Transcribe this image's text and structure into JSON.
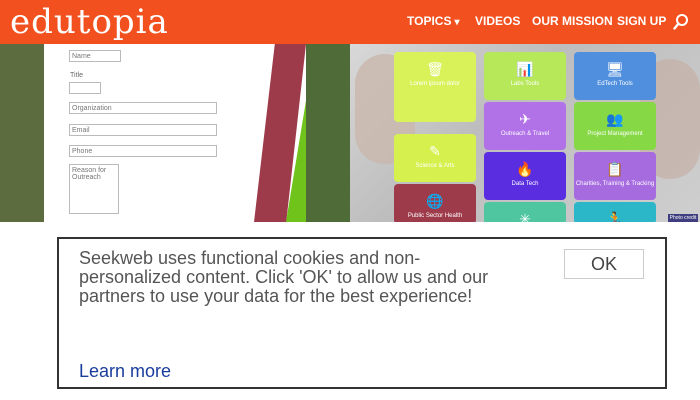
{
  "header": {
    "logo": "edutopia",
    "nav": {
      "topics": "TOPICS",
      "videos": "VIDEOS",
      "mission": "OUR MISSION",
      "signup": "SIGN UP"
    },
    "icons": [
      "chevron-down-icon",
      "search-icon"
    ],
    "brand_color": "#f2511f"
  },
  "hero": {
    "form": {
      "name_placeholder": "Name",
      "title_label": "Title",
      "organization_placeholder": "Organization",
      "email_placeholder": "Email",
      "phone_placeholder": "Phone",
      "comment_placeholder": "Reason for Outreach"
    },
    "tiles": [
      {
        "label": "Lorem ipsum dolor",
        "icon": "trash-icon",
        "color": "#d9f25a"
      },
      {
        "label": "Labs Tools",
        "icon": "chart-icon",
        "color": "#b7e85a"
      },
      {
        "label": "EdTech Tools",
        "icon": "monitor-icon",
        "color": "#4f8fde"
      },
      {
        "label": "Science & Arts",
        "icon": "pencil-icon",
        "color": "#d6f04d"
      },
      {
        "label": "Outreach & Travel",
        "icon": "plane-icon",
        "color": "#b172e8"
      },
      {
        "label": "Project Management",
        "icon": "people-icon",
        "color": "#86d845"
      },
      {
        "label": "Public Sector Health",
        "icon": "globe-icon",
        "color": "#9e3b4b"
      },
      {
        "label": "Data Tech",
        "icon": "fire-icon",
        "color": "#5a2ee0"
      },
      {
        "label": "Charities, Training & Tracking",
        "icon": "clipboard-icon",
        "color": "#a56bdf"
      },
      {
        "label": "",
        "icon": "plant-icon",
        "color": "#4fc6a0"
      },
      {
        "label": "",
        "icon": "running-icon",
        "color": "#2bb7c8"
      }
    ],
    "badge": "Photo credit"
  },
  "cookie": {
    "message": "Seekweb uses functional cookies and non-personalized content. Click 'OK' to allow us and our partners to use your data for the best experience!",
    "learn_more": "Learn more",
    "ok": "OK"
  }
}
